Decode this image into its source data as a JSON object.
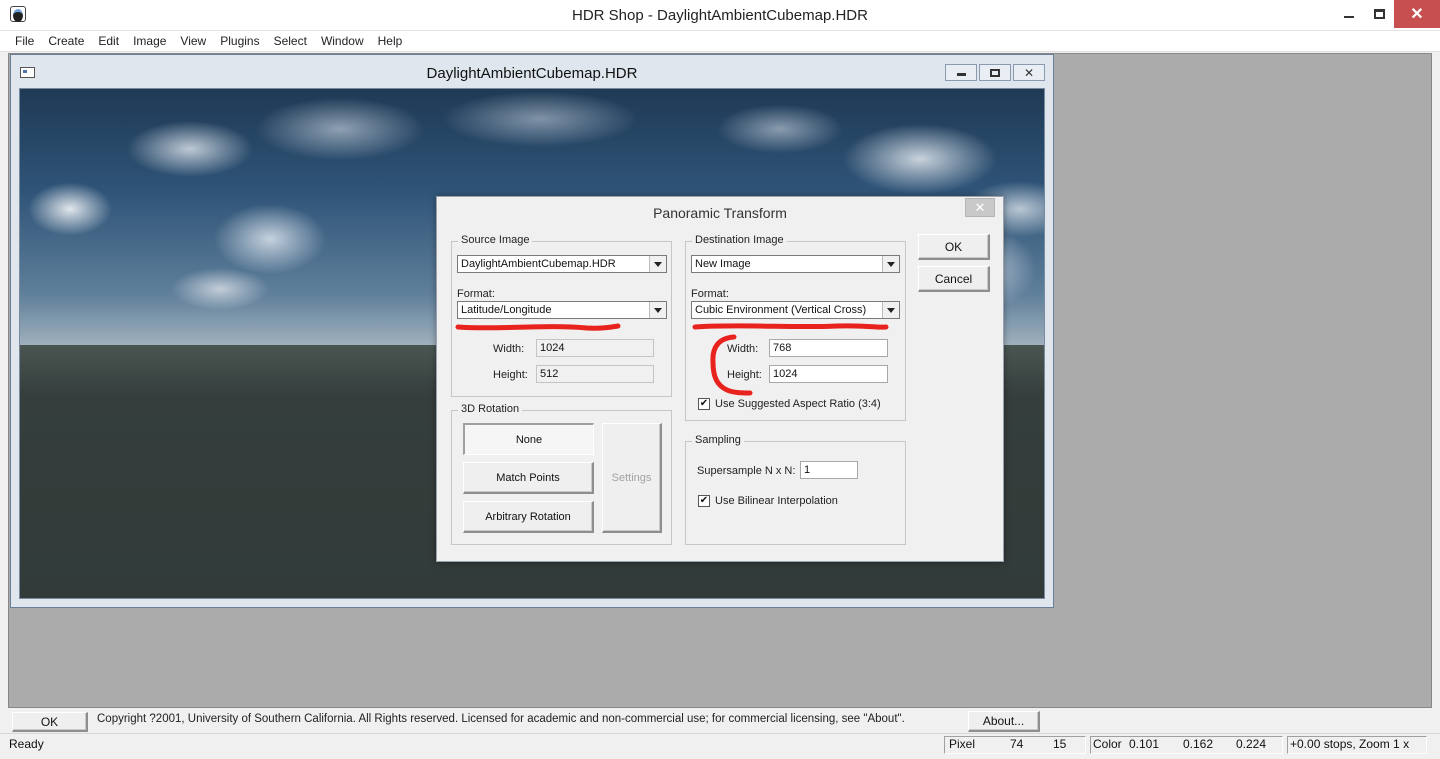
{
  "app": {
    "title": "HDR Shop - DaylightAmbientCubemap.HDR",
    "close_glyph": "✕"
  },
  "menu": [
    "File",
    "Create",
    "Edit",
    "Image",
    "View",
    "Plugins",
    "Select",
    "Window",
    "Help"
  ],
  "child_window": {
    "title": "DaylightAmbientCubemap.HDR",
    "close_glyph": "✕"
  },
  "dialog": {
    "title": "Panoramic Transform",
    "close_glyph": "✕",
    "ok_label": "OK",
    "cancel_label": "Cancel",
    "source": {
      "group_label": "Source Image",
      "image_value": "DaylightAmbientCubemap.HDR",
      "format_label": "Format:",
      "format_value": "Latitude/Longitude",
      "width_label": "Width:",
      "width_value": "1024",
      "height_label": "Height:",
      "height_value": "512"
    },
    "rotation": {
      "group_label": "3D Rotation",
      "none_label": "None",
      "match_points_label": "Match Points",
      "arbitrary_label": "Arbitrary Rotation",
      "settings_label": "Settings"
    },
    "destination": {
      "group_label": "Destination Image",
      "image_value": "New Image",
      "format_label": "Format:",
      "format_value": "Cubic Environment (Vertical Cross)",
      "width_label": "Width:",
      "width_value": "768",
      "height_label": "Height:",
      "height_value": "1024",
      "aspect_label": "Use Suggested Aspect Ratio (3:4)",
      "aspect_checked": true,
      "check_glyph": "✔"
    },
    "sampling": {
      "group_label": "Sampling",
      "supersample_label": "Supersample N x N:",
      "supersample_value": "1",
      "bilinear_label": "Use Bilinear Interpolation",
      "bilinear_checked": true
    }
  },
  "copyright": {
    "ok_label": "OK",
    "text": "Copyright ?2001, University of Southern California.  All Rights reserved.  Licensed for academic and non-commercial use; for commercial licensing, see \"About\".",
    "about_label": "About..."
  },
  "status": {
    "ready": "Ready",
    "pixel_label": "Pixel",
    "pixel_x": "74",
    "pixel_y": "15",
    "color_label": "Color",
    "color_r": "0.101",
    "color_g": "0.162",
    "color_b": "0.224",
    "zoom_text": "+0.00 stops, Zoom 1 x"
  },
  "annotation_color": "#e8231e"
}
